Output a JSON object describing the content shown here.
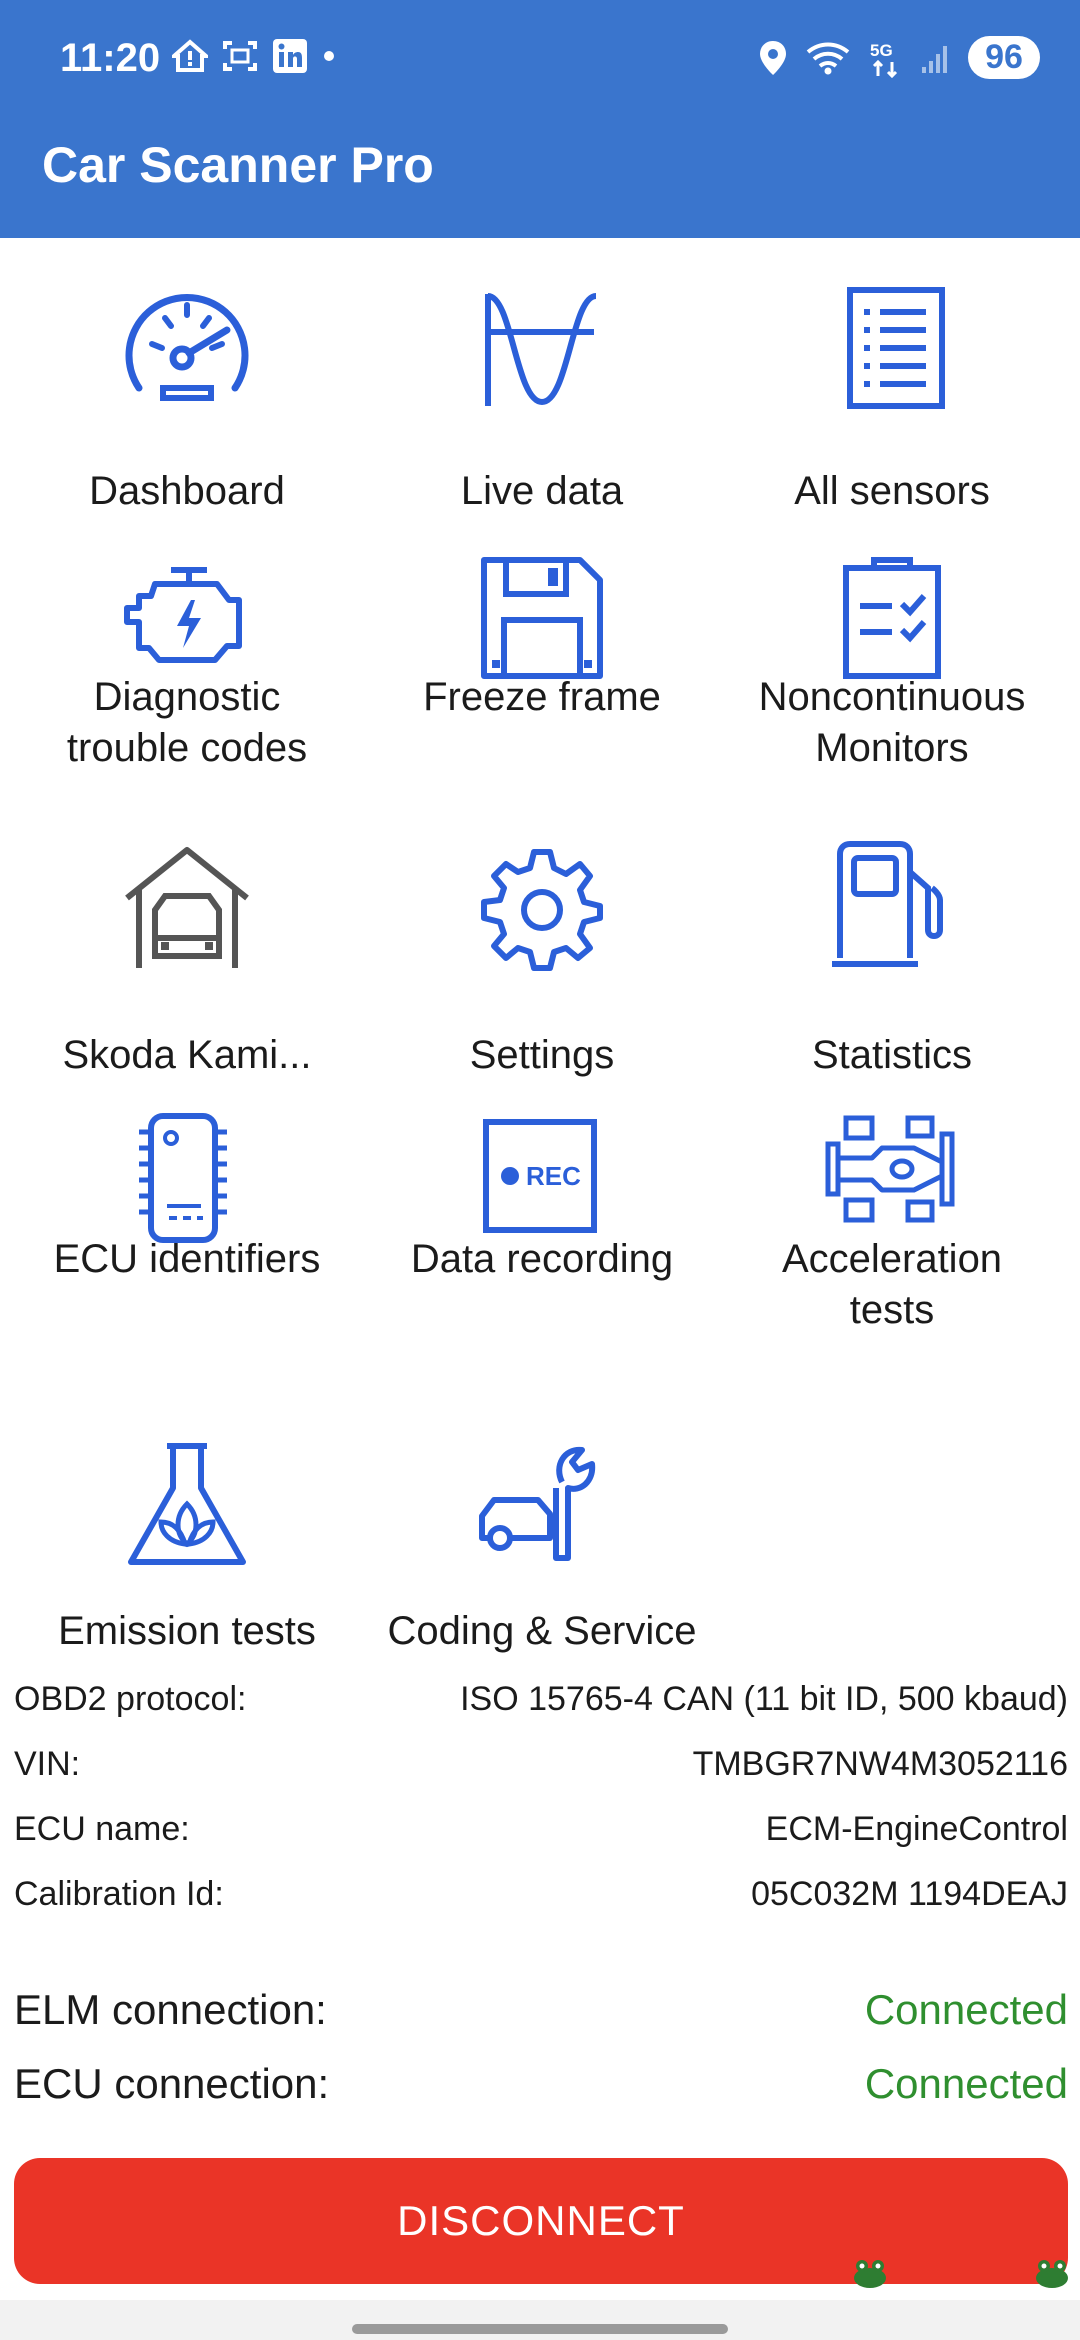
{
  "status_bar": {
    "time": "11:20",
    "battery": "96",
    "left_icons": [
      "home-alert-icon",
      "screenshot-icon",
      "linkedin-icon",
      "dot-icon"
    ],
    "right_icons": [
      "location-icon",
      "wifi-icon",
      "5g-icon",
      "signal-icon"
    ]
  },
  "app": {
    "title": "Car Scanner Pro",
    "accent": "#3a75cd",
    "icon_color": "#2b5fd9"
  },
  "menu": {
    "dashboard": "Dashboard",
    "live_data": "Live data",
    "all_sensors": "All sensors",
    "dtc_line1": "Diagnostic",
    "dtc_line2": "trouble codes",
    "freeze_frame": "Freeze frame",
    "noncont_line1": "Noncontinuous",
    "noncont_line2": "Monitors",
    "vehicle": "Skoda Kami...",
    "settings": "Settings",
    "statistics": "Statistics",
    "ecu_identifiers": "ECU identifiers",
    "data_recording": "Data recording",
    "accel_line1": "Acceleration",
    "accel_line2": "tests",
    "emission_tests": "Emission tests",
    "coding_service": "Coding & Service",
    "rec_text": "REC"
  },
  "info": {
    "protocol_label": "OBD2 protocol:",
    "protocol_value": "ISO 15765-4 CAN (11 bit ID, 500 kbaud)",
    "vin_label": "VIN:",
    "vin_value": "TMBGR7NW4M3052116",
    "ecu_name_label": "ECU name:",
    "ecu_name_value": "ECM-EngineControl",
    "calibration_label": "Calibration Id:",
    "calibration_value": "05C032M 1194DEAJ"
  },
  "connection": {
    "elm_label": "ELM connection:",
    "elm_value": "Connected",
    "ecu_label": "ECU connection:",
    "ecu_value": "Connected",
    "status_color": "#2f8f2f"
  },
  "actions": {
    "disconnect": "DISCONNECT",
    "disconnect_color": "#ea3427"
  }
}
